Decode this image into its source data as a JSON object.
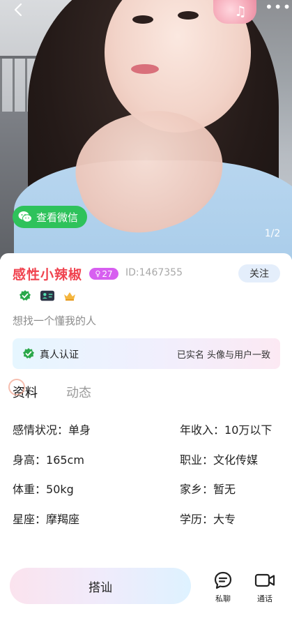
{
  "header": {
    "back_icon": "chevron-left-icon",
    "more_icon": "more-dots-icon",
    "music_icon": "music-note-icon",
    "more_label": "•••",
    "wechat_label": "查看微信",
    "page_indicator": "1/2"
  },
  "profile": {
    "name": "感性小辣椒",
    "age": "27",
    "age_symbol": "♀",
    "user_id": "ID:1467355",
    "follow_label": "关注",
    "bio": "想找一个懂我的人",
    "badges": [
      "verified-shield-icon",
      "id-card-icon",
      "crown-icon"
    ]
  },
  "verification": {
    "title": "真人认证",
    "description": "已实名 头像与用户一致"
  },
  "tabs": [
    {
      "label": "资料"
    },
    {
      "label": "动态"
    }
  ],
  "details": {
    "relationship": {
      "label": "感情状况：",
      "value": "单身"
    },
    "income": {
      "label": "年收入：",
      "value": "10万以下"
    },
    "height": {
      "label": "身高：",
      "value": "165cm"
    },
    "occupation": {
      "label": "职业：",
      "value": "文化传媒"
    },
    "weight": {
      "label": "体重：",
      "value": "50kg"
    },
    "hometown": {
      "label": "家乡：",
      "value": "暂无"
    },
    "zodiac": {
      "label": "星座：",
      "value": "摩羯座"
    },
    "education": {
      "label": "学历：",
      "value": "大专"
    }
  },
  "bottom_bar": {
    "chat_label": "搭讪",
    "private_message_label": "私聊",
    "call_label": "通话"
  },
  "colors": {
    "name": "#f0434f",
    "age_tag": "#d75ff0",
    "wechat_green": "#2ec25b",
    "verify_green": "#2aa84a"
  }
}
